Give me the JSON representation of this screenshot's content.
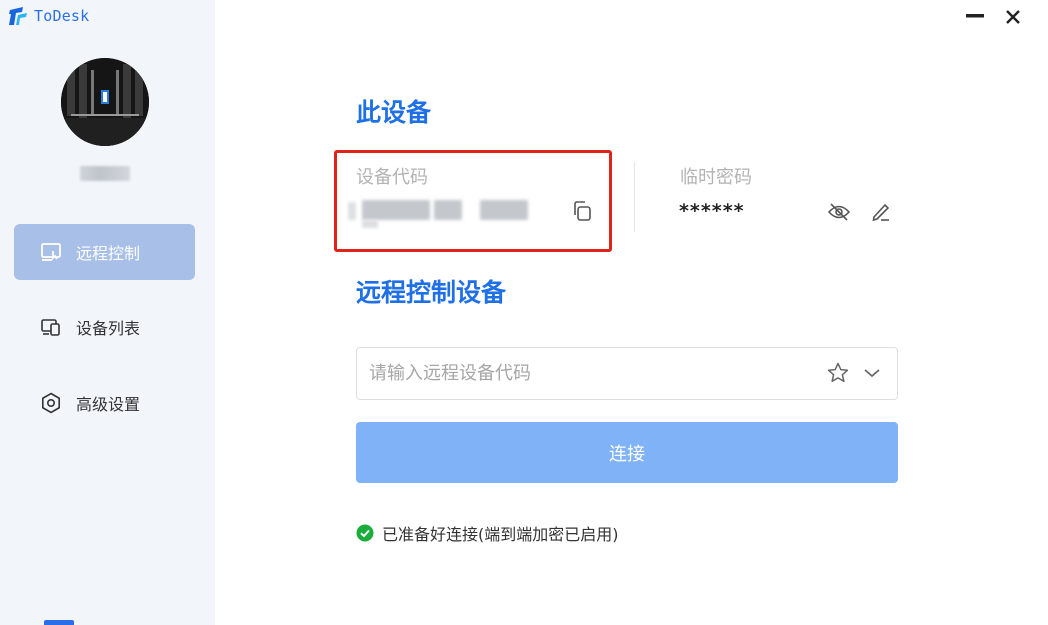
{
  "app": {
    "name": "ToDesk"
  },
  "colors": {
    "accent": "#1f6fe5",
    "highlight": "#e0241b",
    "success": "#1aad3c",
    "button": "#7fb2f7"
  },
  "sidebar": {
    "items": [
      {
        "label": "远程控制",
        "icon": "remote-control-icon",
        "active": true
      },
      {
        "label": "设备列表",
        "icon": "device-list-icon",
        "active": false
      },
      {
        "label": "高级设置",
        "icon": "settings-icon",
        "active": false
      }
    ]
  },
  "device": {
    "title": "此设备",
    "code_label": "设备代码",
    "temp_label": "临时密码",
    "temp_password": "******"
  },
  "remote": {
    "title": "远程控制设备",
    "input_placeholder": "请输入远程设备代码",
    "connect_label": "连接"
  },
  "status": {
    "text": "已准备好连接(端到端加密已启用)"
  }
}
